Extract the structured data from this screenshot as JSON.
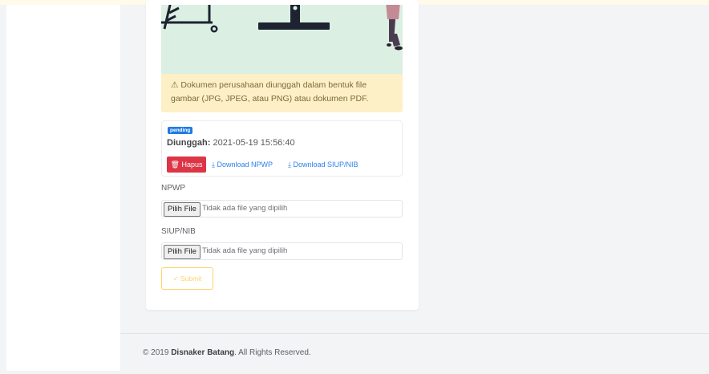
{
  "alert": {
    "icon": "warning-icon",
    "text": "⚠ Dokumen perusahaan diunggah dalam bentuk file gambar (JPG, JPEG, atau PNG) atau dokumen PDF."
  },
  "document_status": {
    "badge": "pending",
    "uploaded_label": "Diunggah:",
    "uploaded_value": "2021-05-19 15:56:40",
    "delete_label": "Hapus",
    "download_npwp_label": "Download NPWP",
    "download_siup_label": "Download SIUP/NIB"
  },
  "form": {
    "npwp_label": "NPWP",
    "npwp_button": "Pilih File",
    "npwp_placeholder": "Tidak ada file yang dipilih",
    "siup_label": "SIUP/NIB",
    "siup_button": "Pilih File",
    "siup_placeholder": "Tidak ada file yang dipilih",
    "submit_label": "Submit"
  },
  "footer": {
    "prefix": "© 2019",
    "brand": "Disnaker Batang",
    "suffix": ". All Rights Reserved."
  },
  "colors": {
    "danger": "#dc3545",
    "link": "#2f80ed",
    "warning_bg": "#fdf0c6",
    "badge": "#1e7be3",
    "submit_border": "#ffd36b"
  }
}
